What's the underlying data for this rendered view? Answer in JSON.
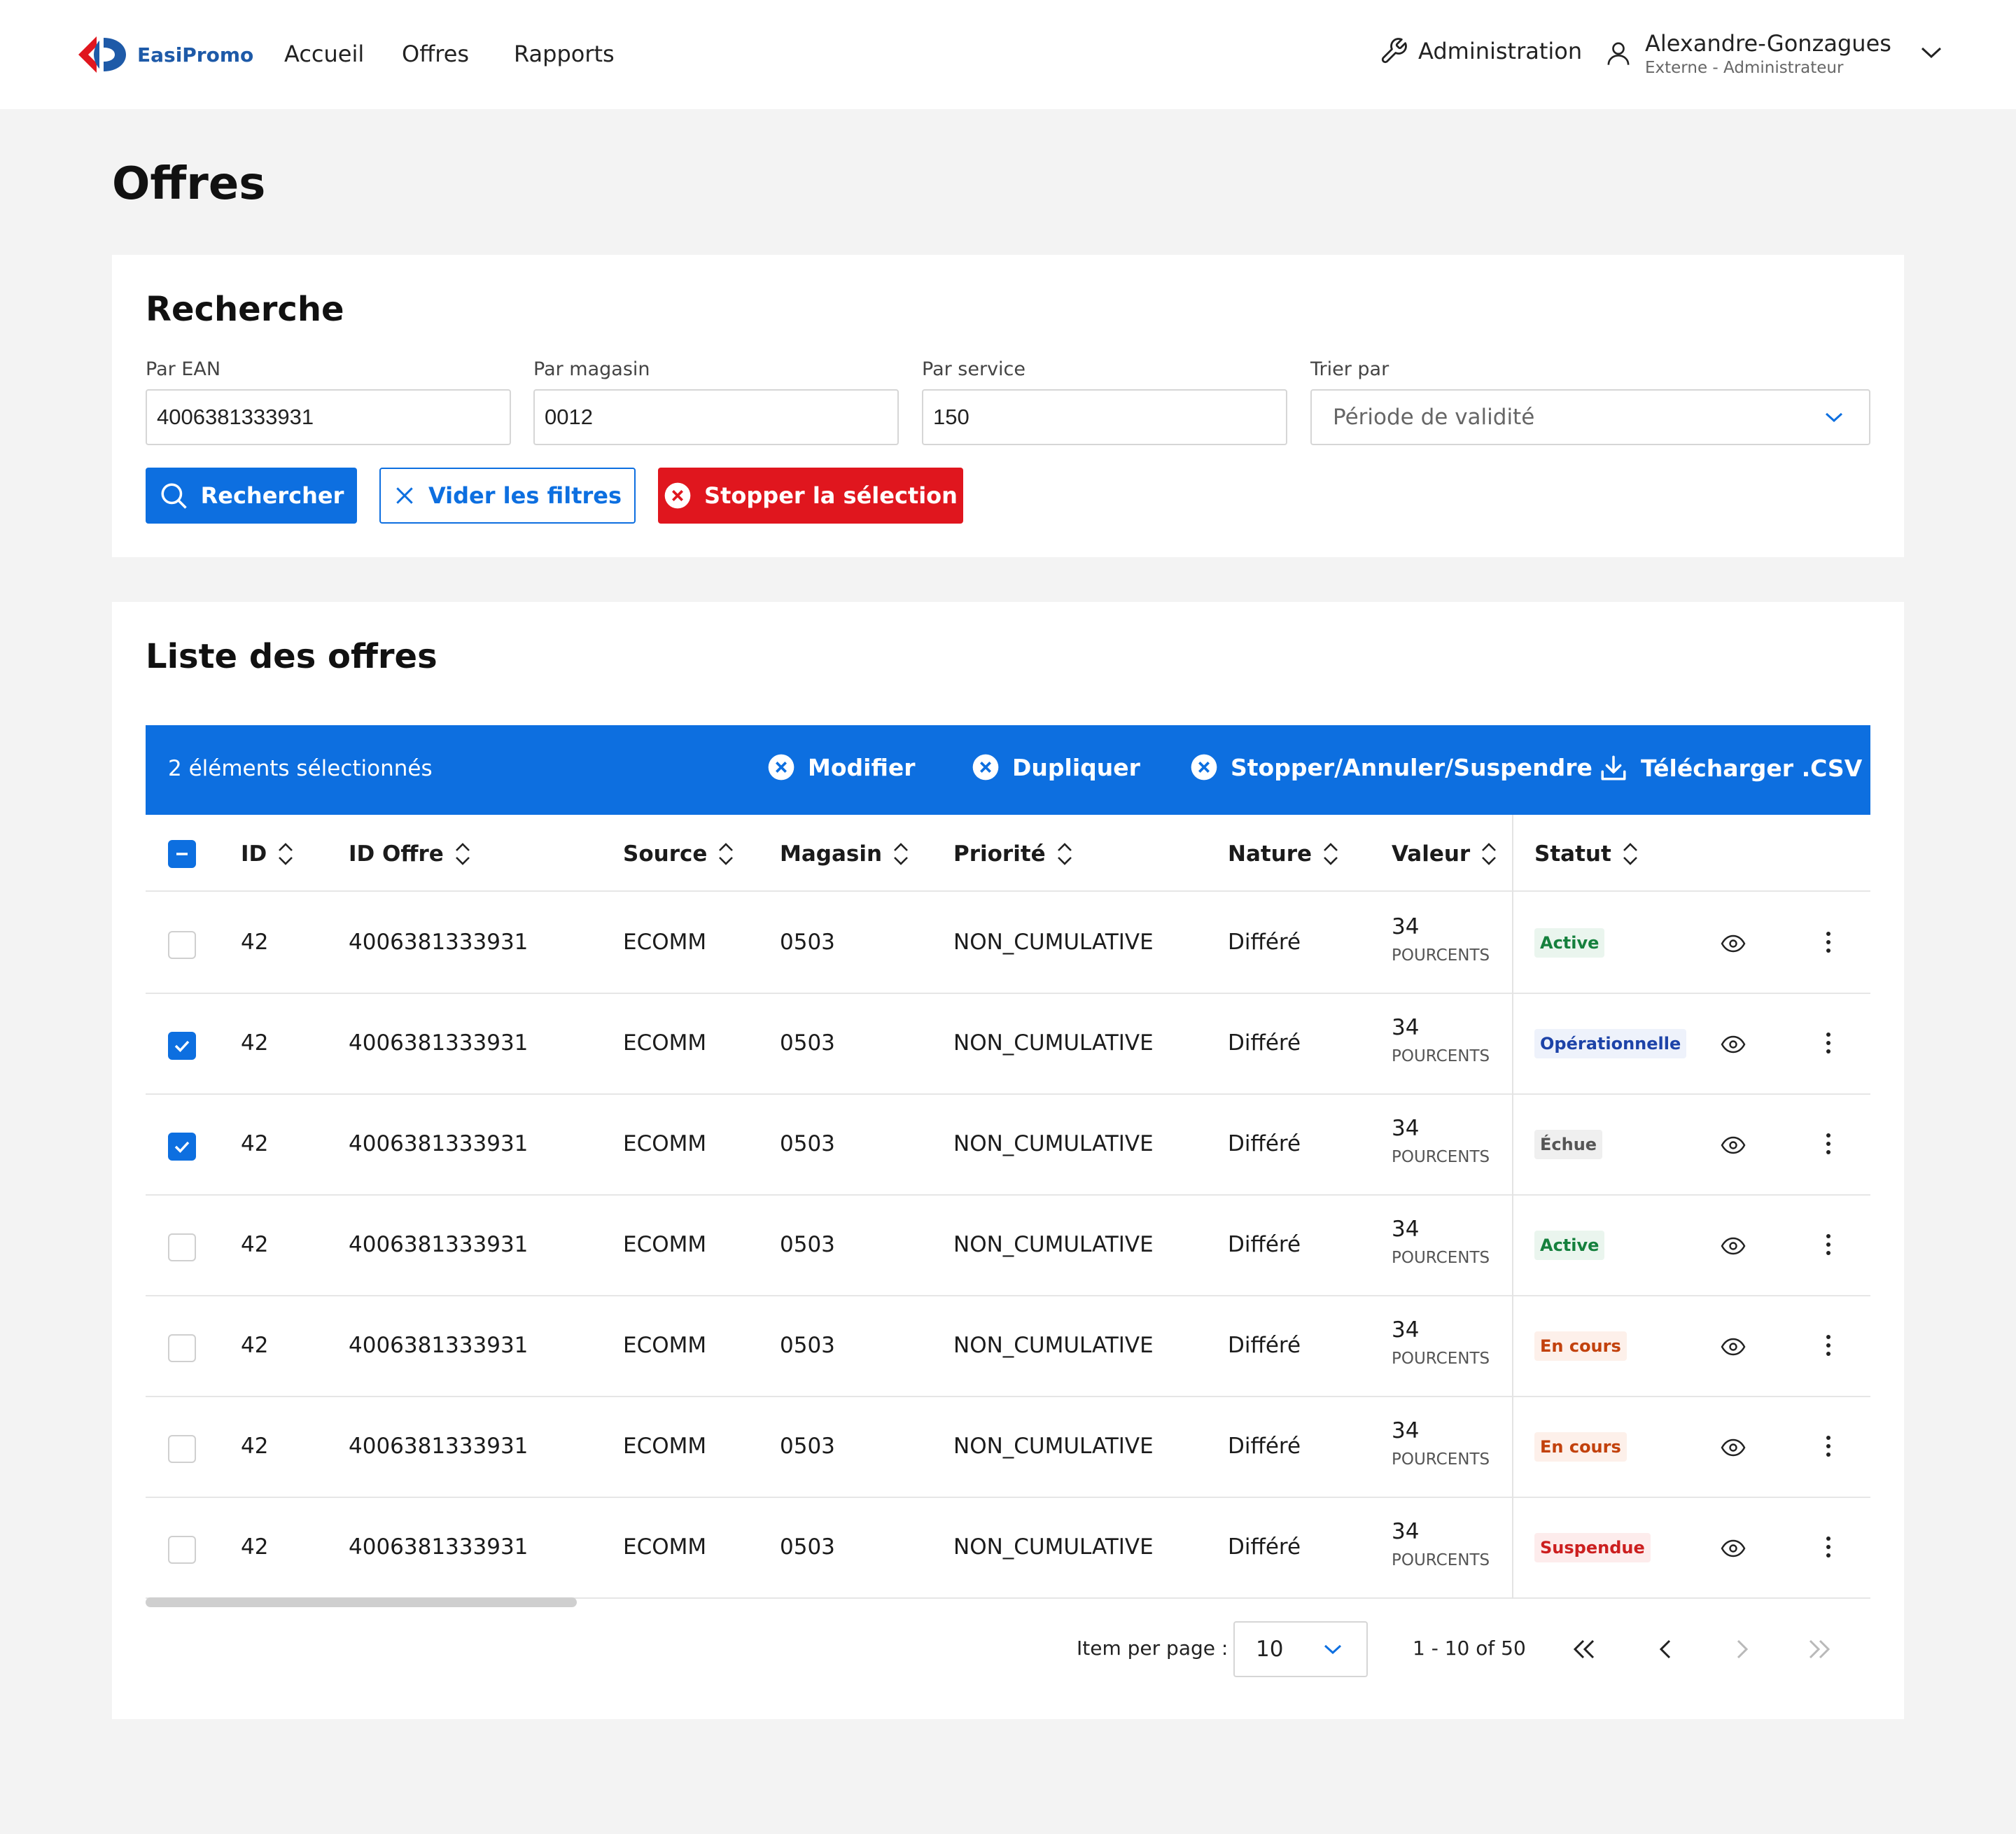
{
  "header": {
    "app_name": "EasiPromo",
    "nav": [
      "Accueil",
      "Offres",
      "Rapports"
    ],
    "admin_label": "Administration",
    "user_name": "Alexandre-Gonzagues",
    "user_role": "Externe - Administrateur"
  },
  "page_title": "Offres",
  "search": {
    "title": "Recherche",
    "ean_label": "Par EAN",
    "ean_value": "4006381333931",
    "store_label": "Par magasin",
    "store_value": "0012",
    "service_label": "Par service",
    "service_value": "150",
    "sort_label": "Trier par",
    "sort_value": "Période de validité",
    "search_button": "Rechercher",
    "clear_button": "Vider les filtres",
    "stop_button": "Stopper la sélection"
  },
  "list": {
    "title": "Liste des offres",
    "selection_count": "2 éléments sélectionnés",
    "actions": {
      "modify": "Modifier",
      "duplicate": "Dupliquer",
      "stop": "Stopper/Annuler/Suspendre",
      "download": "Télécharger .CSV"
    },
    "columns": [
      "ID",
      "ID Offre",
      "Source",
      "Magasin",
      "Priorité",
      "Nature",
      "Valeur",
      "Statut"
    ],
    "rows": [
      {
        "checked": false,
        "id": "42",
        "offer_id": "4006381333931",
        "source": "ECOMM",
        "store": "0503",
        "priority": "NON_CUMULATIVE",
        "nature": "Différé",
        "value": "34",
        "unit": "POURCENTS",
        "status": "Active",
        "status_kind": "active"
      },
      {
        "checked": true,
        "id": "42",
        "offer_id": "4006381333931",
        "source": "ECOMM",
        "store": "0503",
        "priority": "NON_CUMULATIVE",
        "nature": "Différé",
        "value": "34",
        "unit": "POURCENTS",
        "status": "Opérationnelle",
        "status_kind": "oper"
      },
      {
        "checked": true,
        "id": "42",
        "offer_id": "4006381333931",
        "source": "ECOMM",
        "store": "0503",
        "priority": "NON_CUMULATIVE",
        "nature": "Différé",
        "value": "34",
        "unit": "POURCENTS",
        "status": "Échue",
        "status_kind": "echue"
      },
      {
        "checked": false,
        "id": "42",
        "offer_id": "4006381333931",
        "source": "ECOMM",
        "store": "0503",
        "priority": "NON_CUMULATIVE",
        "nature": "Différé",
        "value": "34",
        "unit": "POURCENTS",
        "status": "Active",
        "status_kind": "active"
      },
      {
        "checked": false,
        "id": "42",
        "offer_id": "4006381333931",
        "source": "ECOMM",
        "store": "0503",
        "priority": "NON_CUMULATIVE",
        "nature": "Différé",
        "value": "34",
        "unit": "POURCENTS",
        "status": "En cours",
        "status_kind": "encours"
      },
      {
        "checked": false,
        "id": "42",
        "offer_id": "4006381333931",
        "source": "ECOMM",
        "store": "0503",
        "priority": "NON_CUMULATIVE",
        "nature": "Différé",
        "value": "34",
        "unit": "POURCENTS",
        "status": "En cours",
        "status_kind": "encours"
      },
      {
        "checked": false,
        "id": "42",
        "offer_id": "4006381333931",
        "source": "ECOMM",
        "store": "0503",
        "priority": "NON_CUMULATIVE",
        "nature": "Différé",
        "value": "34",
        "unit": "POURCENTS",
        "status": "Suspendue",
        "status_kind": "susp"
      }
    ]
  },
  "pagination": {
    "items_label": "Item per page :",
    "page_size": "10",
    "range": "1 - 10 of 50"
  },
  "colors": {
    "primary": "#0d6fe0",
    "danger": "#e0161e",
    "brand_blue": "#1e5aa8",
    "brand_red": "#e0161e"
  }
}
